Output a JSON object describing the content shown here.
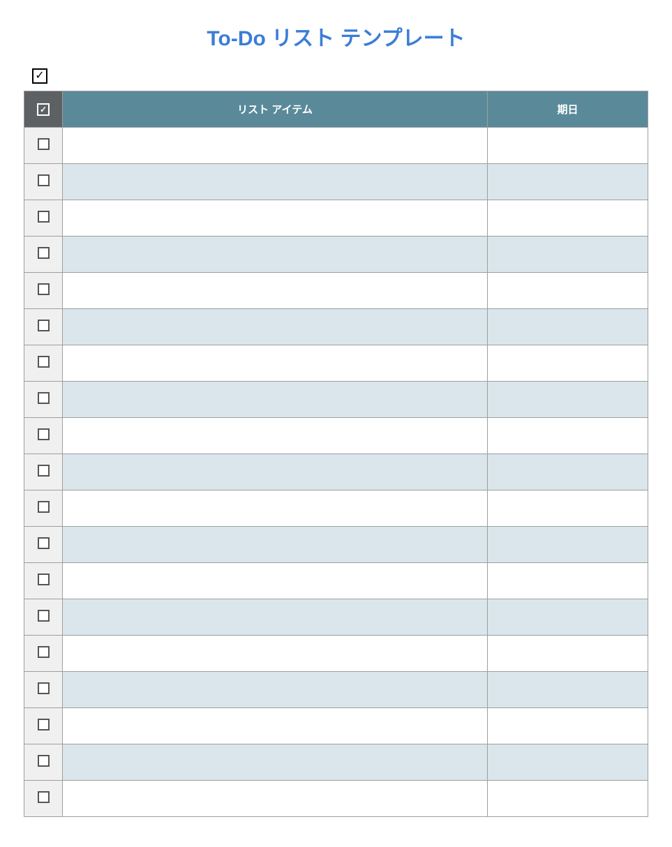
{
  "title": "To-Do リスト テンプレート",
  "topCheckSymbol": "✓",
  "header": {
    "checkSymbol": "✓",
    "itemLabel": "リスト アイテム",
    "dueLabel": "期日"
  },
  "rows": [
    {
      "checked": false,
      "item": "",
      "due": ""
    },
    {
      "checked": false,
      "item": "",
      "due": ""
    },
    {
      "checked": false,
      "item": "",
      "due": ""
    },
    {
      "checked": false,
      "item": "",
      "due": ""
    },
    {
      "checked": false,
      "item": "",
      "due": ""
    },
    {
      "checked": false,
      "item": "",
      "due": ""
    },
    {
      "checked": false,
      "item": "",
      "due": ""
    },
    {
      "checked": false,
      "item": "",
      "due": ""
    },
    {
      "checked": false,
      "item": "",
      "due": ""
    },
    {
      "checked": false,
      "item": "",
      "due": ""
    },
    {
      "checked": false,
      "item": "",
      "due": ""
    },
    {
      "checked": false,
      "item": "",
      "due": ""
    },
    {
      "checked": false,
      "item": "",
      "due": ""
    },
    {
      "checked": false,
      "item": "",
      "due": ""
    },
    {
      "checked": false,
      "item": "",
      "due": ""
    },
    {
      "checked": false,
      "item": "",
      "due": ""
    },
    {
      "checked": false,
      "item": "",
      "due": ""
    },
    {
      "checked": false,
      "item": "",
      "due": ""
    },
    {
      "checked": false,
      "item": "",
      "due": ""
    }
  ]
}
